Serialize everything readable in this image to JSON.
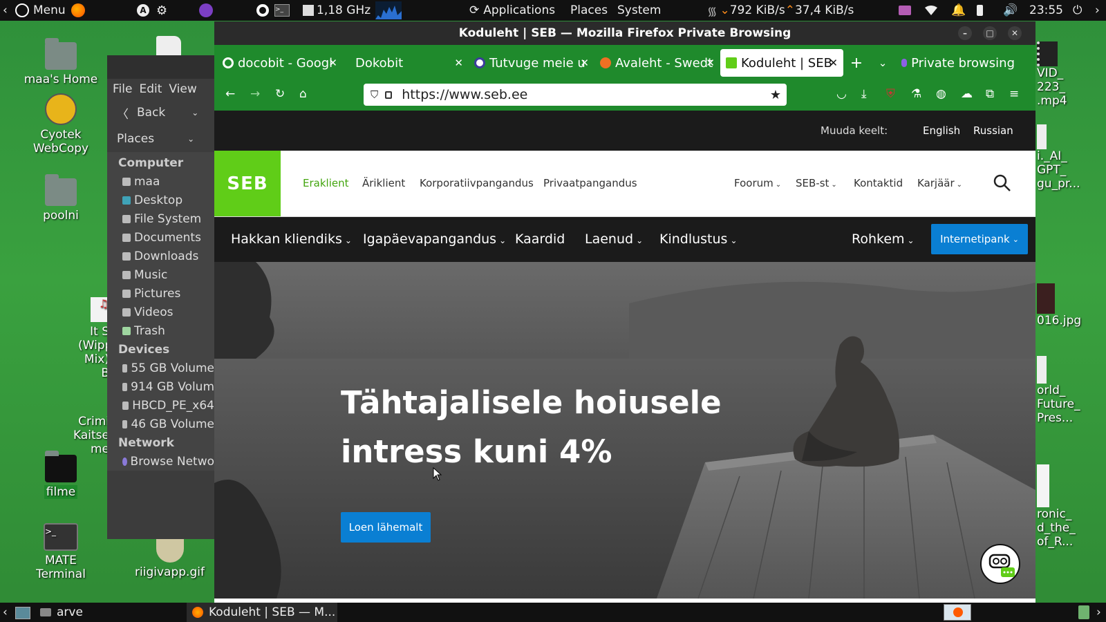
{
  "top_panel": {
    "menu_label": "Menu",
    "cpu_freq": "1,18 GHz",
    "applications": "Applications",
    "places": "Places",
    "system": "System",
    "net_down": "792 KiB/s",
    "net_up": "37,4 KiB/s",
    "clock": "23:55"
  },
  "desktop": {
    "icons_left": [
      "maa's Home",
      "Cyotek WebCopy",
      "poolni",
      "filme",
      "MATE Terminal"
    ],
    "partial_left_text": [
      "It S",
      "(Wippe",
      "Mix)  B",
      "Crimi",
      "Kaitse",
      "me"
    ],
    "riigivapp": "riigivapp.gif",
    "icons_right": [
      "VID_",
      "223_",
      ".mp4",
      "i._AI_",
      "GPT_",
      "gu_pr...",
      "016.jpg",
      "orld_",
      "Future_",
      "Pres...",
      "ronic_",
      "d_the_",
      "of_R..."
    ]
  },
  "file_manager": {
    "menu": [
      "File",
      "Edit",
      "View"
    ],
    "back_label": "Back",
    "places_label": "Places",
    "sections": [
      {
        "title": "Computer",
        "items": [
          "maa",
          "Desktop",
          "File System",
          "Documents",
          "Downloads",
          "Music",
          "Pictures",
          "Videos",
          "Trash"
        ]
      },
      {
        "title": "Devices",
        "items": [
          "55 GB Volume",
          "914 GB Volum",
          "HBCD_PE_x64",
          "46 GB Volume"
        ]
      },
      {
        "title": "Network",
        "items": [
          "Browse Netwo"
        ]
      }
    ]
  },
  "browser": {
    "window_title": "Koduleht | SEB — Mozilla Firefox Private Browsing",
    "tabs": [
      {
        "label": "docobit - Googl",
        "active": false
      },
      {
        "label": "Dokobit",
        "active": false
      },
      {
        "label": "Tutvuge meie u",
        "active": false
      },
      {
        "label": "Avaleht - Swedt",
        "active": false
      },
      {
        "label": "Koduleht | SEB",
        "active": true
      }
    ],
    "private_label": "Private browsing",
    "url": "https://www.seb.ee"
  },
  "page": {
    "lang_prompt": "Muuda keelt:",
    "lang_english": "English",
    "lang_russian": "Russian",
    "logo_text": "SEB",
    "main_nav": [
      "Eraklient",
      "Äriklient",
      "Korporatiivpangandus",
      "Privaatpangandus"
    ],
    "right_nav": [
      "Foorum",
      "SEB-st",
      "Kontaktid",
      "Karjäär"
    ],
    "sub_nav": [
      "Hakkan kliendiks",
      "Igapäevapangandus",
      "Kaardid",
      "Laenud",
      "Kindlustus"
    ],
    "more_label": "Rohkem",
    "netbank_label": "Internetipank",
    "hero_title_line1": "Tähtajalisele hoiusele",
    "hero_title_line2": "intress kuni 4%",
    "hero_button": "Loen lähemalt",
    "accent_green": "#60cd18",
    "accent_blue": "#0a7fd3"
  },
  "taskbar": {
    "item1": "arve",
    "item2": "Koduleht | SEB — M..."
  }
}
